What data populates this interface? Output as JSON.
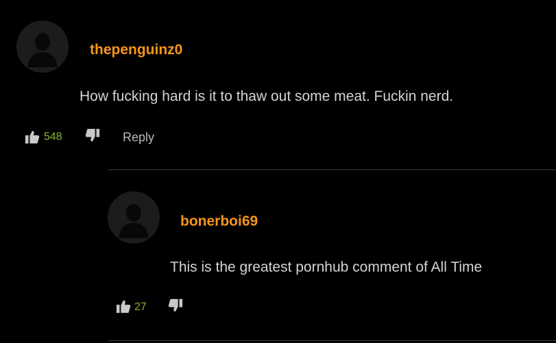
{
  "colors": {
    "username": "#f7951d",
    "vote_count": "#8bb533",
    "background": "#000000",
    "divider": "#3a3a3a"
  },
  "comments": [
    {
      "username": "thepenguinz0",
      "text": "How fucking hard is it to thaw out some meat. Fuckin nerd.",
      "upvotes": "548",
      "reply_label": "Reply",
      "avatar_icon": "default-avatar-icon",
      "upvote_icon": "thumbs-up-icon",
      "downvote_icon": "thumbs-down-icon"
    },
    {
      "username": "bonerboi69",
      "text": "This is the greatest pornhub comment of All Time",
      "upvotes": "27",
      "avatar_icon": "default-avatar-icon",
      "upvote_icon": "thumbs-up-icon",
      "downvote_icon": "thumbs-down-icon"
    }
  ]
}
